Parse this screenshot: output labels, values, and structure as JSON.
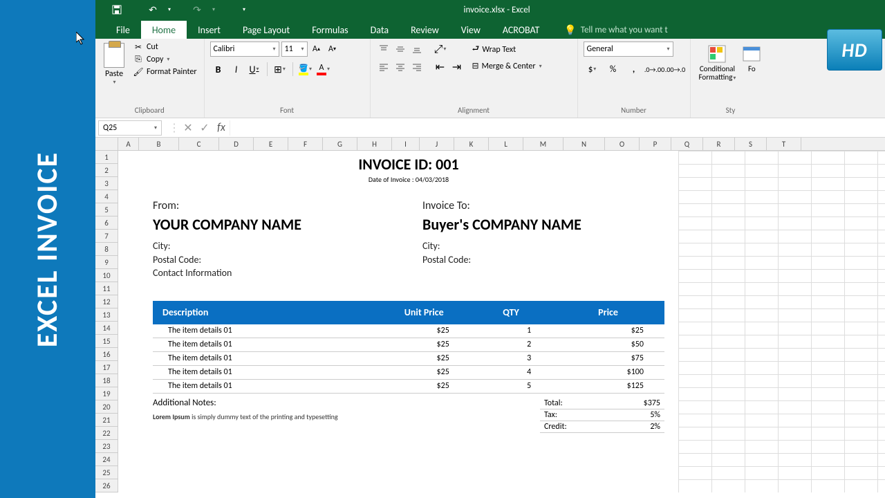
{
  "banner": {
    "text": "EXCEL INVOICE",
    "hd": "HD"
  },
  "titlebar": {
    "title": "invoice.xlsx - Excel"
  },
  "tabs": {
    "file": "File",
    "home": "Home",
    "insert": "Insert",
    "page_layout": "Page Layout",
    "formulas": "Formulas",
    "data": "Data",
    "review": "Review",
    "view": "View",
    "acrobat": "ACROBAT",
    "tell_me": "Tell me what you want t"
  },
  "ribbon": {
    "clipboard": {
      "paste": "Paste",
      "cut": "Cut",
      "copy": "Copy",
      "format_painter": "Format Painter",
      "label": "Clipboard"
    },
    "font": {
      "name": "Calibri",
      "size": "11",
      "label": "Font"
    },
    "alignment": {
      "wrap": "Wrap Text",
      "merge": "Merge & Center",
      "label": "Alignment"
    },
    "number": {
      "format": "General",
      "label": "Number"
    },
    "styles": {
      "conditional": "Conditional",
      "formatting": "Formatting",
      "fo": "Fo",
      "label": "Sty"
    }
  },
  "formula_bar": {
    "name_box": "Q25"
  },
  "columns": [
    "A",
    "B",
    "C",
    "D",
    "E",
    "F",
    "G",
    "H",
    "I",
    "J",
    "K",
    "L",
    "M",
    "N",
    "O",
    "P",
    "Q",
    "R",
    "S",
    "T"
  ],
  "rows": [
    "1",
    "2",
    "3",
    "4",
    "5",
    "6",
    "7",
    "8",
    "9",
    "10",
    "11",
    "12",
    "13",
    "14",
    "15",
    "16",
    "17",
    "18",
    "19",
    "20",
    "21",
    "22",
    "23",
    "24",
    "25",
    "26"
  ],
  "invoice": {
    "id_label": "INVOICE ID: 001",
    "date": "Date of Invoice : 04/03/2018",
    "from_label": "From:",
    "from_name": "YOUR COMPANY NAME",
    "from_city": "City:",
    "from_postal": "Postal Code:",
    "from_contact": "Contact Information",
    "to_label": "Invoice To:",
    "to_name": "Buyer's COMPANY NAME",
    "to_city": "City:",
    "to_postal": "Postal Code:",
    "headers": {
      "desc": "Description",
      "unit": "Unit Price",
      "qty": "QTY",
      "price": "Price"
    },
    "items": [
      {
        "desc": "The item details 01",
        "unit": "$25",
        "qty": "1",
        "price": "$25"
      },
      {
        "desc": "The item details 01",
        "unit": "$25",
        "qty": "2",
        "price": "$50"
      },
      {
        "desc": "The item details 01",
        "unit": "$25",
        "qty": "3",
        "price": "$75"
      },
      {
        "desc": "The item details 01",
        "unit": "$25",
        "qty": "4",
        "price": "$100"
      },
      {
        "desc": "The item details 01",
        "unit": "$25",
        "qty": "5",
        "price": "$125"
      }
    ],
    "notes_h": "Additional Notes:",
    "notes_t": "Lorem Ipsum is simply dummy text of the printing and typesetting",
    "totals": {
      "total_l": "Total:",
      "total_v": "$375",
      "tax_l": "Tax:",
      "tax_v": "5%",
      "credit_l": "Credit:",
      "credit_v": "2%"
    }
  }
}
